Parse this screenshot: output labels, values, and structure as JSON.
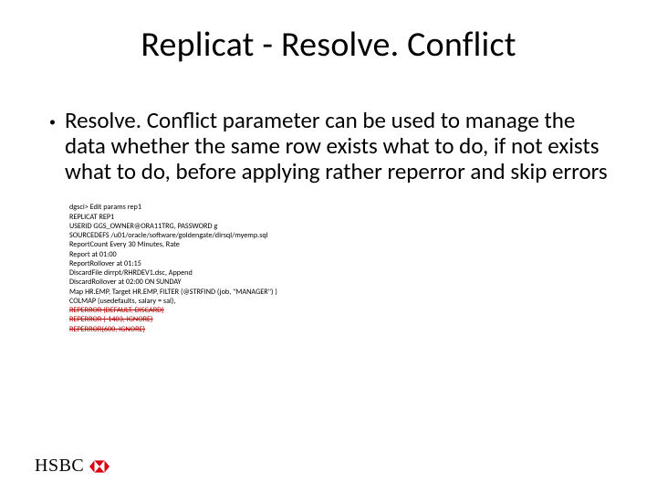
{
  "title": "Replicat - Resolve. Conflict",
  "bullet": "Resolve. Conflict parameter can be used to manage the data whether the same row exists what to do, if not exists what to do, before applying rather reperror and skip errors",
  "code": {
    "l1": "dgsci> Edit params rep1",
    "l2": "REPLICAT REP1",
    "l3": "USERID GGS_OWNER@ORA11TRG, PASSWORD g",
    "l4": "SOURCEDEFS /u01/oracle/software/goldengate/dirsql/myemp.sql",
    "l5": "ReportCount Every 30 Minutes, Rate",
    "l6": "Report at 01:00",
    "l7": "ReportRollover at 01:15",
    "l8": "DiscardFile dirrpt/RHRDEV1.dsc, Append",
    "l9": "DiscardRollover at 02:00 ON SUNDAY",
    "l10": "Map HR.EMP, Target HR.EMP, FILTER (@STRFIND (job, \"MANAGER\") )",
    "l11": "COLMAP (usedefaults, salary = sal),",
    "s1": "REPERROR (DEFAULT, DISCARD)",
    "s2": "REPERROR (-1403, IGNORE)",
    "s3": "REPERROR(600, IGNORE)"
  },
  "logo": {
    "text": "HSBC",
    "icon": "hsbc-hex-icon",
    "red": "#db0011"
  }
}
